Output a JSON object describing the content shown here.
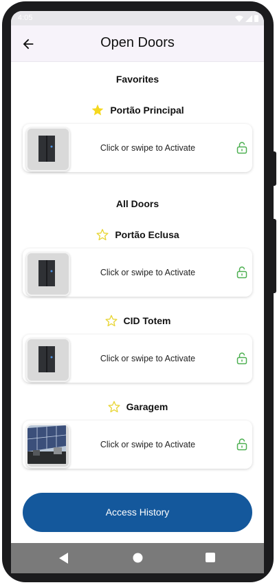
{
  "status_bar": {
    "time": "4:05"
  },
  "app_bar": {
    "title": "Open Doors",
    "back_icon": "arrow-left-icon"
  },
  "sections": {
    "favorites_title": "Favorites",
    "all_doors_title": "All Doors"
  },
  "favorites": [
    {
      "name": "Portão Principal",
      "favorite": true,
      "image": "door-panel-image",
      "action_text": "Click or swipe to Activate",
      "lock_icon": "unlock-icon"
    }
  ],
  "doors": [
    {
      "name": "Portão Eclusa",
      "favorite": false,
      "image": "door-panel-image",
      "action_text": "Click or swipe to Activate",
      "lock_icon": "unlock-icon"
    },
    {
      "name": "CID Totem",
      "favorite": false,
      "image": "door-panel-image",
      "action_text": "Click or swipe to Activate",
      "lock_icon": "unlock-icon"
    },
    {
      "name": "Garagem",
      "favorite": false,
      "image": "solar-panel-photo",
      "action_text": "Click or swipe to Activate",
      "lock_icon": "unlock-icon"
    }
  ],
  "history_button": {
    "label": "Access History"
  },
  "colors": {
    "primary": "#14589c",
    "star_filled": "#f5d81f",
    "star_outline": "#e8d534",
    "unlock_green": "#4caf50"
  }
}
